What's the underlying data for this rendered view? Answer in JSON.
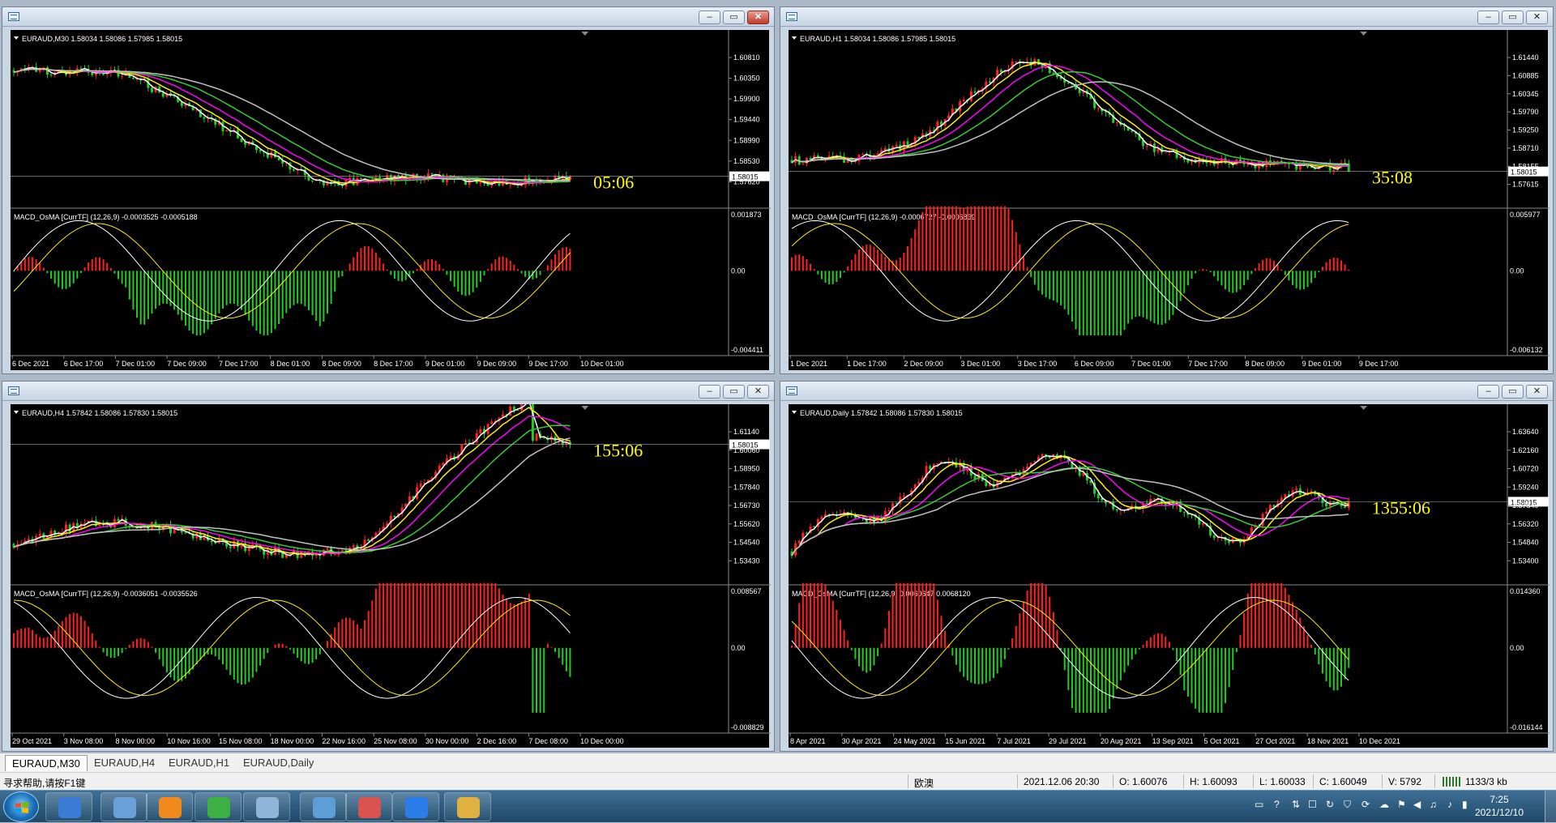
{
  "windows": [
    {
      "title": "EURAUD,M30",
      "info": "EURAUD,M30  1.58034 1.58086 1.57985 1.58015",
      "timer": "05:06",
      "macd_label": "MACD_OsMA [CurrTF] (12,26,9) -0.0003525 -0.0005188",
      "price_ticks": [
        "1.60810",
        "1.60350",
        "1.59900",
        "1.59440",
        "1.58990",
        "1.58530",
        "1.57620"
      ],
      "current_price": "1.58015",
      "macd_ticks": [
        "0.001873",
        "0.00",
        "-0.004411"
      ],
      "time_ticks": [
        "6 Dec 2021",
        "6 Dec 17:00",
        "7 Dec 01:00",
        "7 Dec 09:00",
        "7 Dec 17:00",
        "8 Dec 01:00",
        "8 Dec 09:00",
        "8 Dec 17:00",
        "9 Dec 01:00",
        "9 Dec 09:00",
        "9 Dec 17:00",
        "10 Dec 01:00"
      ],
      "trend": "down",
      "close_active": true
    },
    {
      "title": "EURAUD,H1",
      "info": "EURAUD,H1  1.58034 1.58086 1.57985 1.58015",
      "timer": "35:08",
      "macd_label": "MACD_OsMA [CurrTF] (12,26,9) -0.0006727 -0.0006839",
      "price_ticks": [
        "1.61440",
        "1.60885",
        "1.60345",
        "1.59790",
        "1.59250",
        "1.58710",
        "1.58155",
        "1.57615"
      ],
      "current_price": "1.58015",
      "macd_ticks": [
        "0.005977",
        "0.00",
        "-0.006132"
      ],
      "time_ticks": [
        "1 Dec 2021",
        "1 Dec 17:00",
        "2 Dec 09:00",
        "3 Dec 01:00",
        "3 Dec 17:00",
        "6 Dec 09:00",
        "7 Dec 01:00",
        "7 Dec 17:00",
        "8 Dec 09:00",
        "9 Dec 01:00",
        "9 Dec 17:00"
      ],
      "trend": "hump",
      "close_active": false
    },
    {
      "title": "EURAUD,H4",
      "info": "EURAUD,H4  1.57842 1.58086 1.57830 1.58015",
      "timer": "155:06",
      "macd_label": "MACD_OsMA [CurrTF] (12,26,9) -0.0036051 -0.0035526",
      "price_ticks": [
        "1.61140",
        "1.60060",
        "1.58950",
        "1.57840",
        "1.56730",
        "1.55620",
        "1.54540",
        "1.53430"
      ],
      "current_price": "1.58015",
      "macd_ticks": [
        "0.008567",
        "0.00",
        "-0.008829"
      ],
      "time_ticks": [
        "29 Oct 2021",
        "3 Nov 08:00",
        "8 Nov 00:00",
        "10 Nov 16:00",
        "15 Nov 08:00",
        "18 Nov 00:00",
        "22 Nov 16:00",
        "25 Nov 08:00",
        "30 Nov 00:00",
        "2 Dec 16:00",
        "7 Dec 08:00",
        "10 Dec 00:00"
      ],
      "trend": "up",
      "close_active": false
    },
    {
      "title": "EURAUD,Daily",
      "info": "EURAUD,Daily  1.57842 1.58086 1.57830 1.58015",
      "timer": "1355:06",
      "macd_label": "MACD_OsMA [CurrTF] (12,26,9) 0.0060647 0.0068120",
      "price_ticks": [
        "1.63640",
        "1.62160",
        "1.60720",
        "1.59240",
        "1.57840",
        "1.56320",
        "1.54840",
        "1.53400"
      ],
      "current_price": "1.58015",
      "macd_ticks": [
        "0.014360",
        "0.00",
        "-0.016144"
      ],
      "time_ticks": [
        "8 Apr 2021",
        "30 Apr 2021",
        "24 May 2021",
        "15 Jun 2021",
        "7 Jul 2021",
        "29 Jul 2021",
        "20 Aug 2021",
        "13 Sep 2021",
        "5 Oct 2021",
        "27 Oct 2021",
        "18 Nov 2021",
        "10 Dec 2021"
      ],
      "trend": "wave",
      "close_active": false
    }
  ],
  "colors": {
    "bull": "#ff2020",
    "bear": "#22cc22",
    "ma_fast": "#ffffff",
    "ma_yellow": "#ffee00",
    "ma_magenta": "#ff00ff",
    "ma_green": "#32cd32",
    "ma_silver": "#c0c0c0",
    "timer": "#ffff00",
    "axis_text": "#ffffff"
  },
  "tabs": [
    "EURAUD,M30",
    "EURAUD,H4",
    "EURAUD,H1",
    "EURAUD,Daily"
  ],
  "status": {
    "help": "寻求帮助,请按F1键",
    "profile": "欧澳",
    "datetime": "2021.12.06 20:30",
    "open": "O: 1.60076",
    "high": "H: 1.60093",
    "low": "L: 1.60033",
    "close": "C: 1.60049",
    "volume": "V: 5792",
    "traffic": "1133/3 kb"
  },
  "clock": {
    "time": "7:25",
    "date": "2021/12/10"
  },
  "taskbar_apps": [
    "monitor-app",
    "control-panel-app",
    "refresh-app",
    "wechat-app",
    "paper-app",
    "chart-app",
    "paint-app",
    "notes-app",
    "explorer-app"
  ]
}
